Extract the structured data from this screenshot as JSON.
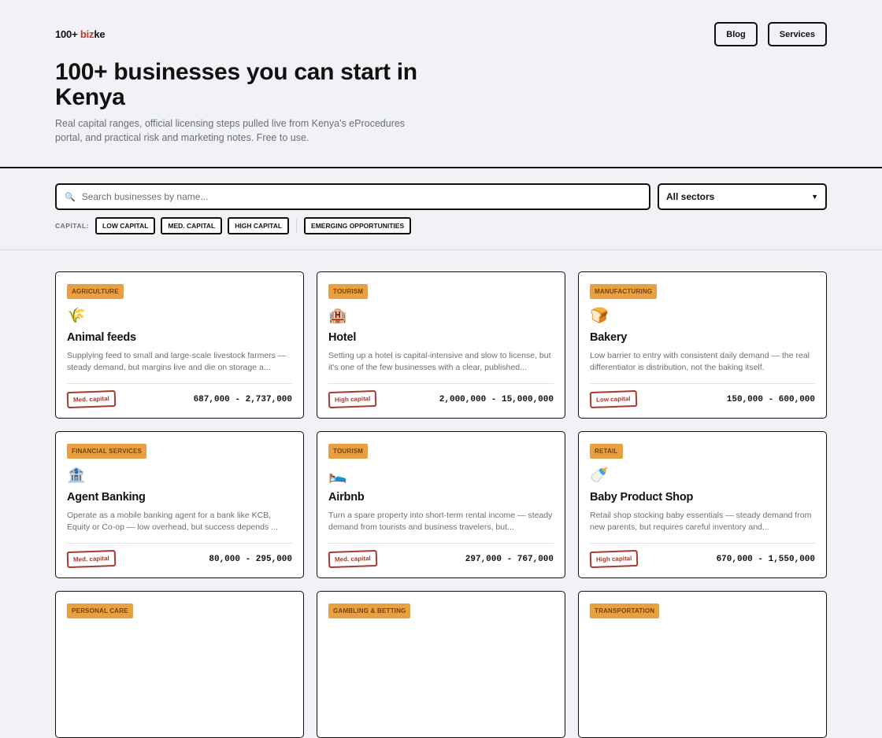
{
  "brand": {
    "prefix": "100+ ",
    "biz": "biz",
    "suffix": "ke"
  },
  "nav": {
    "blog": "Blog",
    "services": "Services"
  },
  "hero": {
    "title": "100+ businesses you can start in Kenya",
    "subtitle": "Real capital ranges, official licensing steps pulled live from Kenya's eProcedures portal, and practical risk and marketing notes. Free to use."
  },
  "filters": {
    "search_placeholder": "Search businesses by name...",
    "sector_value": "All sectors",
    "capital_label": "CAPITAL:",
    "low": "LOW CAPITAL",
    "med": "MED. CAPITAL",
    "high": "HIGH CAPITAL",
    "emerging": "EMERGING OPPORTUNITIES"
  },
  "cards": [
    {
      "tag": "AGRICULTURE",
      "emoji": "🌾",
      "title": "Animal feeds",
      "desc": "Supplying feed to small and large-scale livestock farmers — steady demand, but margins live and die on storage a...",
      "capital": "Med. capital",
      "range": "687,000 - 2,737,000"
    },
    {
      "tag": "TOURISM",
      "emoji": "🏨",
      "title": "Hotel",
      "desc": "Setting up a hotel is capital-intensive and slow to license, but it's one of the few businesses with a clear, published...",
      "capital": "High capital",
      "range": "2,000,000 - 15,000,000"
    },
    {
      "tag": "MANUFACTURING",
      "emoji": "🍞",
      "title": "Bakery",
      "desc": "Low barrier to entry with consistent daily demand — the real differentiator is distribution, not the baking itself.",
      "capital": "Low capital",
      "range": "150,000 - 600,000"
    },
    {
      "tag": "FINANCIAL SERVICES",
      "emoji": "🏦",
      "title": "Agent Banking",
      "desc": "Operate as a mobile banking agent for a bank like KCB, Equity or Co-op — low overhead, but success depends ...",
      "capital": "Med. capital",
      "range": "80,000 - 295,000"
    },
    {
      "tag": "TOURISM",
      "emoji": "🛌",
      "title": "Airbnb",
      "desc": "Turn a spare property into short-term rental income — steady demand from tourists and business travelers, but...",
      "capital": "Med. capital",
      "range": "297,000 - 767,000"
    },
    {
      "tag": "RETAIL",
      "emoji": "🍼",
      "title": "Baby Product Shop",
      "desc": "Retail shop stocking baby essentials — steady demand from new parents, but requires careful inventory and...",
      "capital": "High capital",
      "range": "670,000 - 1,550,000"
    },
    {
      "tag": "PERSONAL CARE",
      "emoji": "",
      "title": "",
      "desc": "",
      "capital": "",
      "range": ""
    },
    {
      "tag": "GAMBLING & BETTING",
      "emoji": "",
      "title": "",
      "desc": "",
      "capital": "",
      "range": ""
    },
    {
      "tag": "TRANSPORTATION",
      "emoji": "",
      "title": "",
      "desc": "",
      "capital": "",
      "range": ""
    }
  ]
}
